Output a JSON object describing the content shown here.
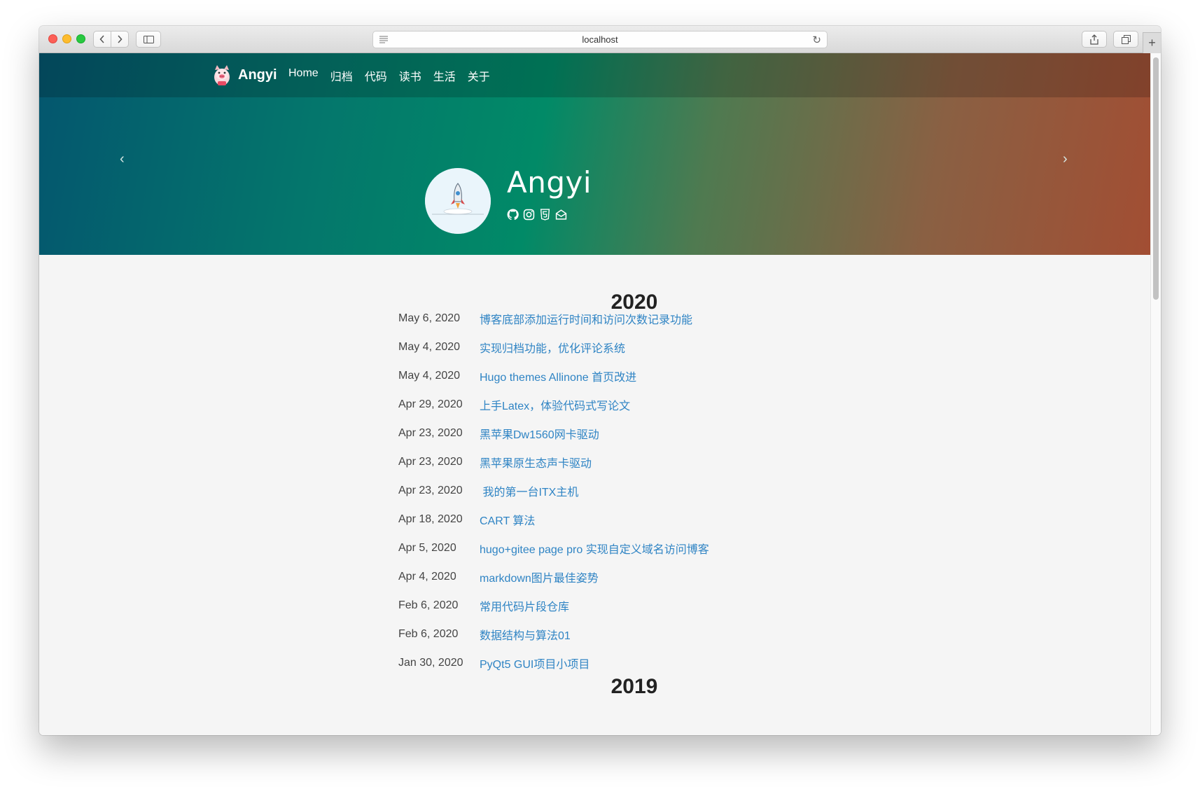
{
  "browser": {
    "url": "localhost"
  },
  "site": {
    "brand": "Angyi",
    "nav": [
      "Home",
      "归档",
      "代码",
      "读书",
      "生活",
      "关于"
    ]
  },
  "hero": {
    "name": "Angyi",
    "social_icons": [
      "github-icon",
      "instagram-icon",
      "html5-icon",
      "email-icon"
    ]
  },
  "archive": {
    "year": "2020",
    "next_year": "2019",
    "posts": [
      {
        "date": "May 6, 2020",
        "title": "博客底部添加运行时间和访问次数记录功能"
      },
      {
        "date": "May 4, 2020",
        "title": "实现归档功能，优化评论系统"
      },
      {
        "date": "May 4, 2020",
        "title": "Hugo themes Allinone 首页改进"
      },
      {
        "date": "Apr 29, 2020",
        "title": "上手Latex，体验代码式写论文"
      },
      {
        "date": "Apr 23, 2020",
        "title": "黑苹果Dw1560网卡驱动"
      },
      {
        "date": "Apr 23, 2020",
        "title": "黑苹果原生态声卡驱动"
      },
      {
        "date": "Apr 23, 2020",
        "title": " 我的第一台ITX主机"
      },
      {
        "date": "Apr 18, 2020",
        "title": "CART 算法"
      },
      {
        "date": "Apr 5, 2020",
        "title": "hugo+gitee page pro 实现自定义域名访问博客"
      },
      {
        "date": "Apr 4, 2020",
        "title": "markdown图片最佳姿势"
      },
      {
        "date": "Feb 6, 2020",
        "title": "常用代码片段仓库"
      },
      {
        "date": "Feb 6, 2020",
        "title": "数据结构与算法01"
      },
      {
        "date": "Jan 30, 2020",
        "title": "PyQt5 GUI项目小项目"
      }
    ]
  },
  "colors": {
    "link": "#2f84c4",
    "hero_start": "#04566e",
    "hero_end": "#a24e33"
  }
}
